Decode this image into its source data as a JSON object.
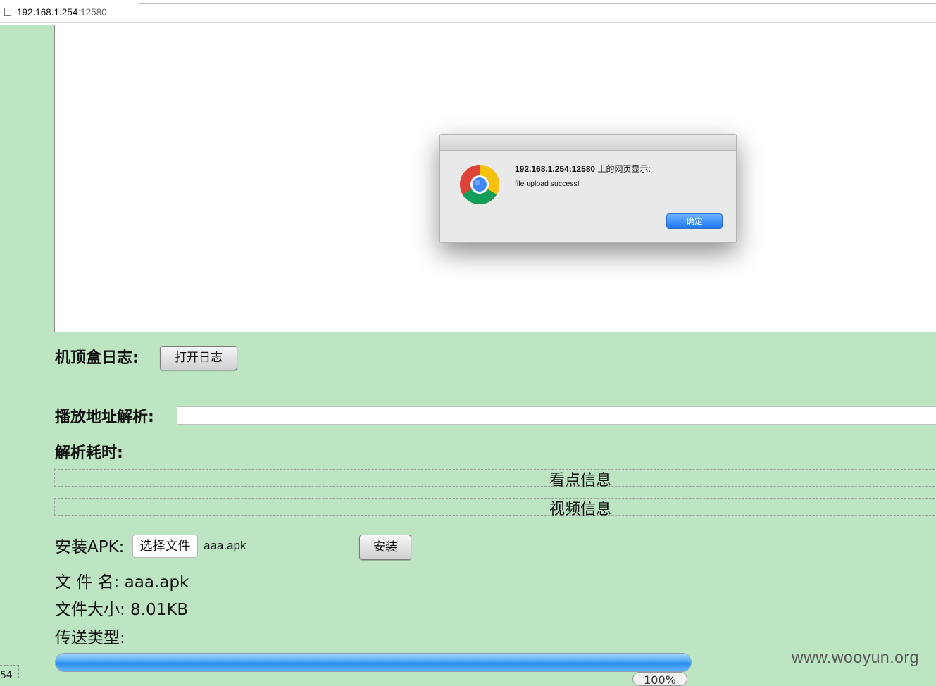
{
  "browser": {
    "url_host": "192.168.1.254",
    "url_port": ":12580"
  },
  "dialog": {
    "title_host": "192.168.1.254:12580",
    "title_suffix": " 上的网页显示:",
    "message": "file upload success!",
    "ok_label": "确定"
  },
  "log": {
    "label": "机顶盒日志:",
    "button_label": "打开日志"
  },
  "parse": {
    "label": "播放地址解析:",
    "input_value": "",
    "time_label": "解析耗时:"
  },
  "panels": {
    "points_info": "看点信息",
    "video_info": "视频信息"
  },
  "install": {
    "label": "安装APK:",
    "choose_file_label": "选择文件",
    "selected_file": "aaa.apk",
    "install_button": "安装",
    "file_name_line": "文 件 名: aaa.apk",
    "file_size_line": "文件大小: 8.01KB",
    "transfer_type_line": "传送类型:",
    "progress": 1.0,
    "progress_text": "100%"
  },
  "corner_number": "54",
  "watermark": "www.wooyun.org"
}
